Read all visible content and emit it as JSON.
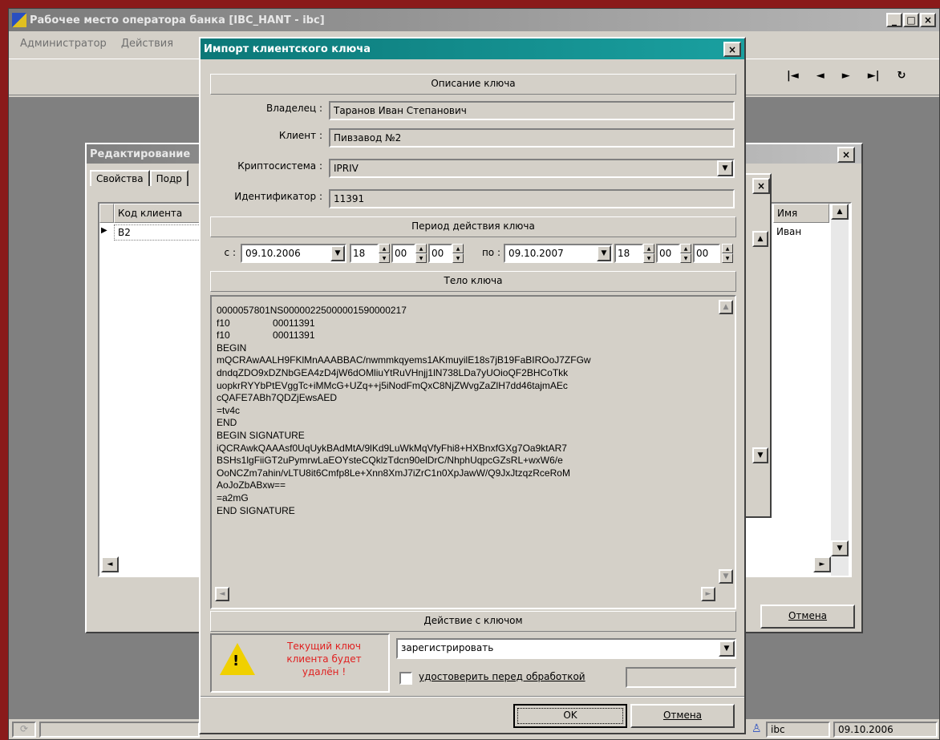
{
  "main_window": {
    "title": "Рабочее место оператора банка [IBC_HANT - ibc]",
    "menu": [
      "Администратор",
      "Действия"
    ],
    "title_buttons": [
      "_",
      "□",
      "×"
    ],
    "nav_buttons": [
      "|◄",
      "◄",
      "►",
      "►|",
      "↻"
    ],
    "status": {
      "user": "ibc",
      "date": "09.10.2006"
    }
  },
  "edit_window": {
    "title": "Редактирование",
    "tabs": [
      "Свойства",
      "Подр"
    ],
    "table": {
      "headers": [
        "Код клиента",
        "Имя"
      ],
      "rows": [
        [
          "B2",
          "Иван"
        ]
      ]
    },
    "cancel_label": "Отмена"
  },
  "dialog": {
    "title": "Импорт клиентского ключа",
    "close": "×",
    "section_description": "Описание ключа",
    "owner_label": "Владелец :",
    "owner_value": "Таранов Иван Степанович",
    "client_label": "Клиент :",
    "client_value": "Пивзавод №2",
    "crypto_label": "Криптосистема :",
    "crypto_value": "IPRIV",
    "id_label": "Идентификатор :",
    "id_value": "11391",
    "section_period": "Период действия ключа",
    "from_label": "с :",
    "from_date": "09.10.2006",
    "from_h": "18",
    "from_m": "00",
    "from_s": "00",
    "to_label": "по :",
    "to_date": "09.10.2007",
    "to_h": "18",
    "to_m": "00",
    "to_s": "00",
    "section_body": "Тело ключа",
    "key_body": "0000057801NS00000225000001590000217\nf10                00011391\nf10                00011391\nBEGIN\nmQCRAwAALH9FKlMnAAABBAC/nwmmkqyems1AKmuyilE18s7jB19FaBIROoJ7ZFGw\ndndqZDO9xDZNbGEA4zD4jW6dOMliuYtRuVHnjj1lN738LDa7yUOioQF2BHCoTkk\nuopkrRYYbPtEVggTc+iMMcG+UZq++j5iNodFmQxC8NjZWvgZaZlH7dd46tajmAEc\ncQAFE7ABh7QDZjEwsAED\n=tv4c\nEND\nBEGIN SIGNATURE\niQCRAwkQAAAsf0UqUykBAdMtA/9lKd9LuWkMqVfyFhi8+HXBnxfGXg7Oa9ktAR7\nBSHs1lgFiiGT2uPymrwLaEOYsteCQklzTdcn90elDrC/NhphUqpcGZsRL+wxW6/e\nOoNCZm7ahin/vLTU8it6Cmfp8Le+Xnn8XmJ7iZrC1n0XpJawW/Q9JxJtzqzRceRoM\nAoJoZbABxw==\n=a2mG\nEND SIGNATURE",
    "section_action": "Действие с ключом",
    "warning": "Текущий ключ клиента будет удалён !",
    "action_value": "зарегистрировать",
    "verify_label": "удостоверить перед обработкой",
    "ok_label": "OK",
    "cancel_label": "Отмена"
  }
}
